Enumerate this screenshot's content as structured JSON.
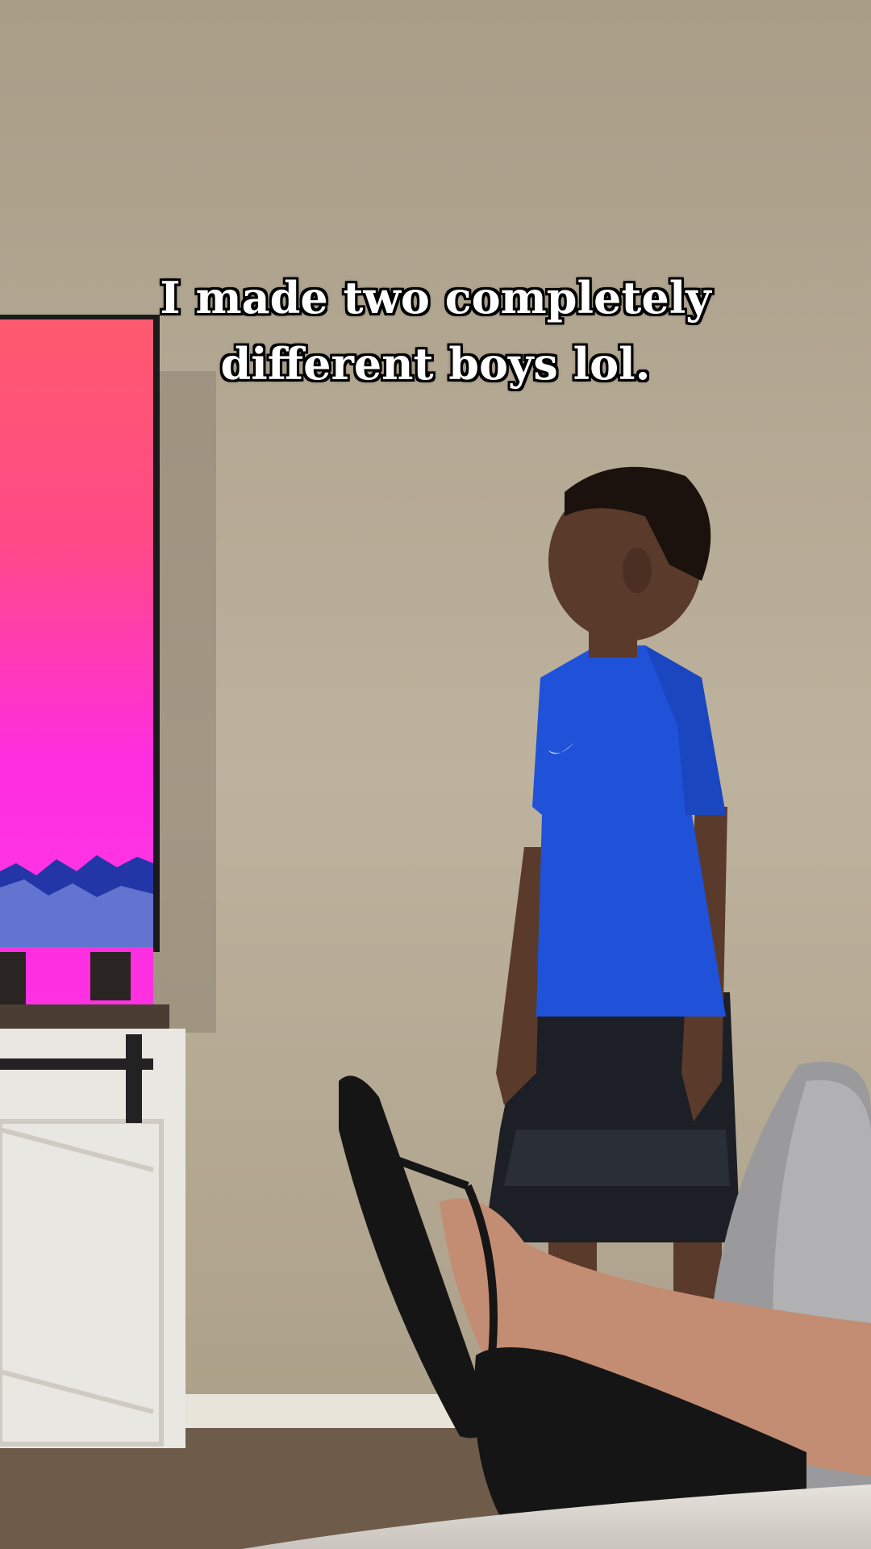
{
  "caption": {
    "line1": "I made two completely",
    "line2": "different boys lol."
  },
  "scene": {
    "wall_color": "#b9ad98",
    "floor_color": "#6e5b4a",
    "tv_gradient_top": "#ff5a6e",
    "tv_gradient_bottom": "#ff2ee0",
    "shirt_color": "#1f52d9",
    "shorts_color": "#1c1f25",
    "cabinet_color": "#e9e7e1"
  }
}
